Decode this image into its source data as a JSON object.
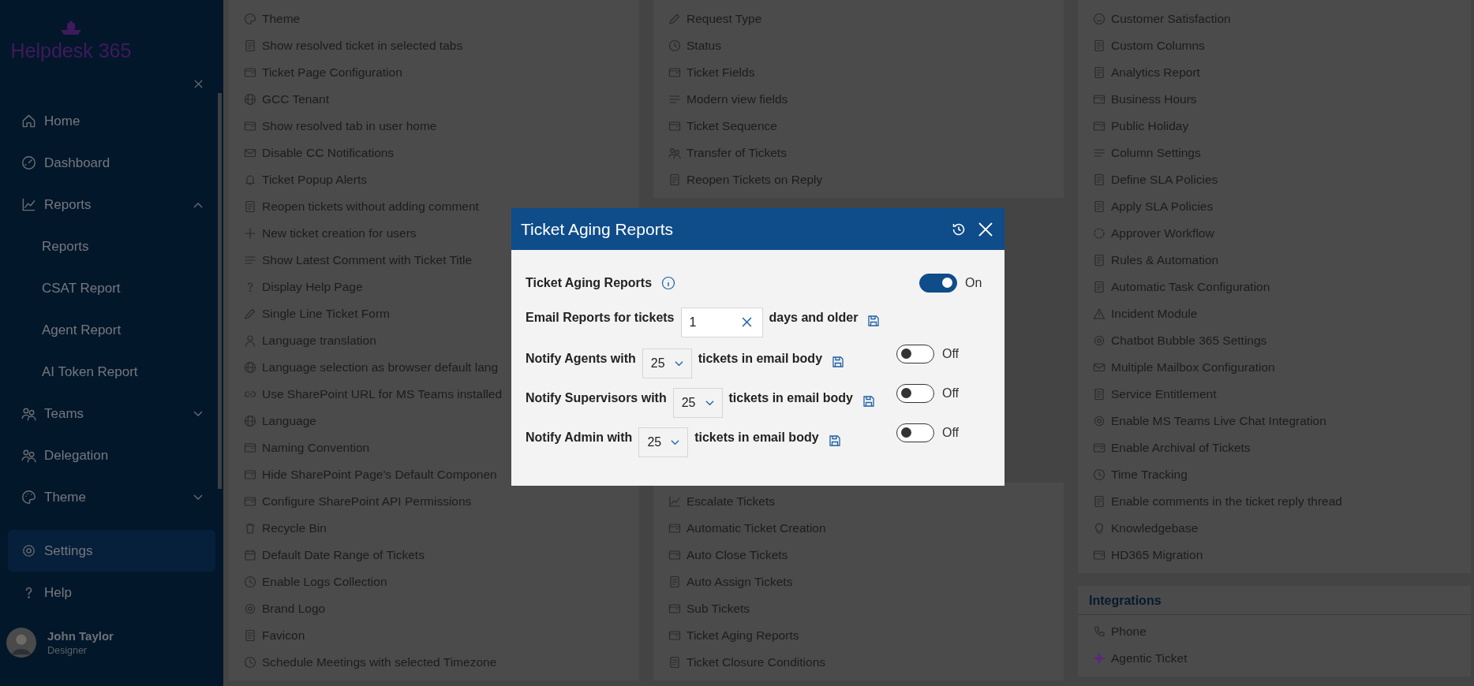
{
  "sidebar": {
    "brand": "Helpdesk 365",
    "items": [
      {
        "kind": "item",
        "label": "Home",
        "selected": false
      },
      {
        "kind": "item",
        "label": "Dashboard",
        "selected": false
      },
      {
        "kind": "group",
        "label": "Reports",
        "expanded": true,
        "selected": false
      },
      {
        "kind": "subitem",
        "label": "Reports",
        "selected": false
      },
      {
        "kind": "subitem",
        "label": "CSAT Report",
        "selected": false
      },
      {
        "kind": "subitem",
        "label": "Agent Report",
        "selected": false
      },
      {
        "kind": "subitem",
        "label": "AI Token Report",
        "selected": false
      },
      {
        "kind": "group",
        "label": "Teams",
        "expanded": false,
        "selected": false
      },
      {
        "kind": "item",
        "label": "Delegation",
        "selected": false
      },
      {
        "kind": "group",
        "label": "Theme",
        "expanded": false,
        "selected": false
      },
      {
        "kind": "item",
        "label": "Settings",
        "selected": true
      },
      {
        "kind": "item",
        "label": "Help",
        "selected": false
      }
    ],
    "user": {
      "name": "John Taylor",
      "role": "Designer"
    }
  },
  "settings_columns": [
    {
      "groups": [
        {
          "items": [
            "Theme",
            "Show resolved ticket in selected tabs",
            "Ticket Page Configuration",
            "GCC Tenant",
            "Show resolved tab in user home",
            "Disable CC Notifications",
            "Ticket Popup Alerts",
            "Reopen tickets without adding comment",
            "New ticket creation for users",
            "Show Latest Comment with Ticket Title",
            "Display Help Page",
            "Single Line Ticket Form",
            "Language translation",
            "Language selection as browser default lang",
            "Use SharePoint URL for MS Teams installed",
            "Language",
            "Naming Convention",
            "Hide SharePoint Page's Default Componen",
            "Configure SharePoint API Permissions",
            "Recycle Bin",
            "Default Date Range of Tickets",
            "Enable Logs Collection",
            "Brand Logo",
            "Favicon",
            "Schedule Meetings with selected Timezone"
          ]
        }
      ]
    },
    {
      "groups": [
        {
          "items": [
            "Request Type",
            "Status",
            "Ticket Fields",
            "Modern view fields",
            "Ticket Sequence",
            "Transfer of Tickets",
            "Reopen Tickets on Reply"
          ]
        },
        {
          "items": [
            "Escalate Tickets",
            "Automatic Ticket Creation",
            "Auto Close Tickets",
            "Auto Assign Tickets",
            "Sub Tickets",
            "Ticket Aging Reports",
            "Ticket Closure Conditions"
          ]
        }
      ]
    },
    {
      "groups": [
        {
          "items": [
            "Customer Satisfaction",
            "Custom Columns",
            "Analytics Report",
            "Business Hours",
            "Public Holiday",
            "Column Settings",
            "Define SLA Policies",
            "Apply SLA Policies",
            "Approver Workflow",
            "Rules & Automation",
            "Automatic Task Configuration",
            "Incident Module",
            "Chatbot Bubble 365 Settings",
            "Multiple Mailbox Configuration",
            "Service Entitlement",
            "Enable MS Teams Live Chat Integration",
            "Enable Archival of Tickets",
            "Time Tracking",
            "Enable comments in the ticket reply thread",
            "Knowledgebase",
            "HD365 Migration"
          ]
        },
        {
          "heading": "Integrations",
          "items": [
            "Phone",
            "Agentic Ticket"
          ]
        }
      ]
    }
  ],
  "modal": {
    "title": "Ticket Aging Reports",
    "rows": [
      {
        "kind": "toggle",
        "label": "Ticket Aging Reports",
        "on": true,
        "state_label": "On"
      },
      {
        "kind": "input",
        "label": "Email Reports for tickets",
        "value": "1",
        "suffix": "days and older"
      },
      {
        "kind": "select",
        "label": "Notify Agents with",
        "value": "25",
        "suffix": "tickets in email body",
        "on": false,
        "state_label": "Off"
      },
      {
        "kind": "select",
        "label": "Notify Supervisors with",
        "value": "25",
        "suffix": "tickets in email body",
        "on": false,
        "state_label": "Off"
      },
      {
        "kind": "select",
        "label": "Notify Admin with",
        "value": "25",
        "suffix": "tickets in email body",
        "on": false,
        "state_label": "Off"
      }
    ]
  }
}
